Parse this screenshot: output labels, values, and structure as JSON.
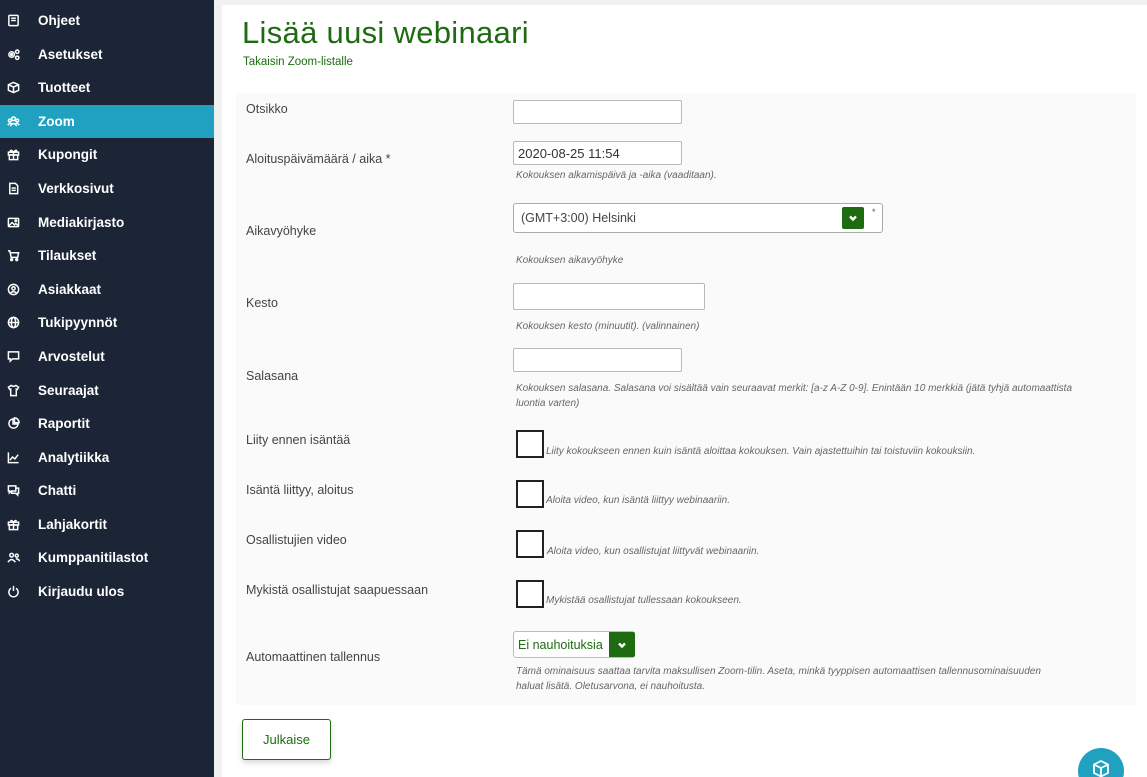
{
  "sidebar": {
    "items": [
      {
        "label": "Ohjeet",
        "icon": "book-icon",
        "active": false
      },
      {
        "label": "Asetukset",
        "icon": "gears-icon",
        "active": false
      },
      {
        "label": "Tuotteet",
        "icon": "box-icon",
        "active": false
      },
      {
        "label": "Zoom",
        "icon": "users-icon",
        "active": true
      },
      {
        "label": "Kupongit",
        "icon": "gift-icon",
        "active": false
      },
      {
        "label": "Verkkosivut",
        "icon": "file-icon",
        "active": false
      },
      {
        "label": "Mediakirjasto",
        "icon": "image-icon",
        "active": false
      },
      {
        "label": "Tilaukset",
        "icon": "cart-icon",
        "active": false
      },
      {
        "label": "Asiakkaat",
        "icon": "user-circle-icon",
        "active": false
      },
      {
        "label": "Tukipyynnöt",
        "icon": "globe-icon",
        "active": false
      },
      {
        "label": "Arvostelut",
        "icon": "comment-icon",
        "active": false
      },
      {
        "label": "Seuraajat",
        "icon": "shirt-icon",
        "active": false
      },
      {
        "label": "Raportit",
        "icon": "pie-chart-icon",
        "active": false
      },
      {
        "label": "Analytiikka",
        "icon": "line-chart-icon",
        "active": false
      },
      {
        "label": "Chatti",
        "icon": "chat-icon",
        "active": false
      },
      {
        "label": "Lahjakortit",
        "icon": "gift-card-icon",
        "active": false
      },
      {
        "label": "Kumppanitilastot",
        "icon": "partners-icon",
        "active": false
      },
      {
        "label": "Kirjaudu ulos",
        "icon": "power-icon",
        "active": false
      }
    ]
  },
  "header": {
    "title": "Lisää uusi webinaari",
    "back_link": "Takaisin Zoom-listalle"
  },
  "form": {
    "title_label": "Otsikko",
    "title_value": "",
    "start_label": "Aloituspäivämäärä / aika *",
    "start_value": "2020-08-25 11:54",
    "start_help": "Kokouksen alkamispäivä ja -aika (vaaditaan).",
    "timezone_label": "Aikavyöhyke",
    "timezone_value": "(GMT+3:00) Helsinki",
    "timezone_asterisk": "*",
    "timezone_help": "Kokouksen aikavyöhyke",
    "duration_label": "Kesto",
    "duration_value": "",
    "duration_help": "Kokouksen kesto (minuutit). (valinnainen)",
    "password_label": "Salasana",
    "password_value": "",
    "password_help_1": "Kokouksen salasana. Salasana voi sisältää vain seuraavat merkit: [a-z A-Z 0-9]. Enintään 10 merkkiä (jätä tyhjä automaattista",
    "password_help_2": "luontia varten)",
    "join_before_label": "Liity ennen isäntää",
    "join_before_help": "Liity kokoukseen ennen kuin isäntä aloittaa kokouksen. Vain ajastettuihin tai toistuviin kokouksiin.",
    "join_before_checked": false,
    "host_video_label": "Isäntä liittyy, aloitus",
    "host_video_help": "Aloita video, kun isäntä liittyy webinaariin.",
    "host_video_checked": false,
    "participant_video_label": "Osallistujien video",
    "participant_video_help": "Aloita video, kun osallistujat liittyvät webinaariin.",
    "participant_video_checked": false,
    "mute_label": "Mykistä osallistujat saapuessaan",
    "mute_help": "Mykistää osallistujat tullessaan kokoukseen.",
    "mute_checked": false,
    "recording_label": "Automaattinen tallennus",
    "recording_value": "Ei nauhoituksia",
    "recording_help_1": "Tämä ominaisuus saattaa tarvita maksullisen Zoom-tilin. Aseta, minkä tyyppisen automaattisen tallennusominaisuuden",
    "recording_help_2": "haluat lisätä. Oletusarvona, ei nauhoitusta."
  },
  "actions": {
    "publish_label": "Julkaise"
  },
  "colors": {
    "sidebar_bg": "#1b2535",
    "accent": "#20a1bf",
    "brand_green": "#1e6b12"
  }
}
